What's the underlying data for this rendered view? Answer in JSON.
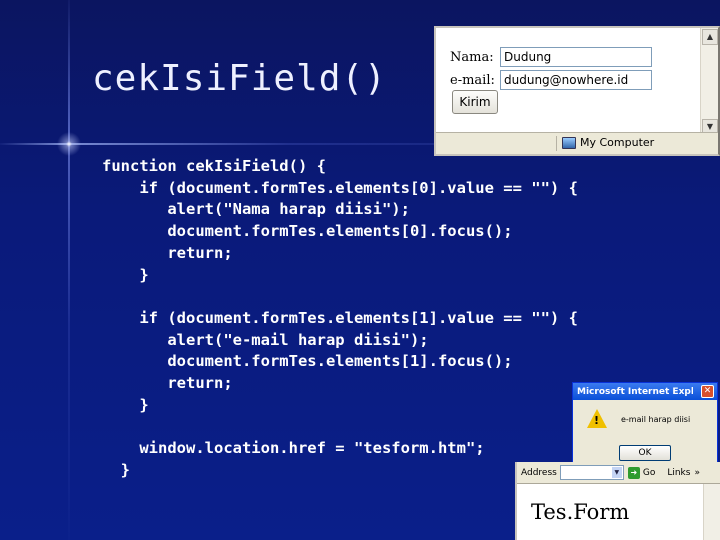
{
  "slide": {
    "title": "cekIsiField()",
    "code": "function cekIsiField() {\n    if (document.formTes.elements[0].value == \"\") {\n       alert(\"Nama harap diisi\");\n       document.formTes.elements[0].focus();\n       return;\n    }\n\n    if (document.formTes.elements[1].value == \"\") {\n       alert(\"e-mail harap diisi\");\n       document.formTes.elements[1].focus();\n       return;\n    }\n\n    window.location.href = \"tesform.htm\";\n  }"
  },
  "form_window": {
    "name_label": "Nama:",
    "name_value": "Dudung",
    "email_label": "e-mail:",
    "email_value": "dudung@nowhere.id",
    "submit_label": "Kirim",
    "status_zone": "My Computer"
  },
  "alert_dialog": {
    "title": "Microsoft Internet Explorer",
    "message": "e-mail harap diisi",
    "ok_label": "OK"
  },
  "tesform_window": {
    "address_label": "Address",
    "go_label": "Go",
    "links_label": "Links",
    "chevron": "»",
    "heading": "Tes.Form"
  },
  "colors": {
    "background": "#0a1a7a",
    "title_text": "#eef0ff",
    "code_text": "#ffffff"
  }
}
